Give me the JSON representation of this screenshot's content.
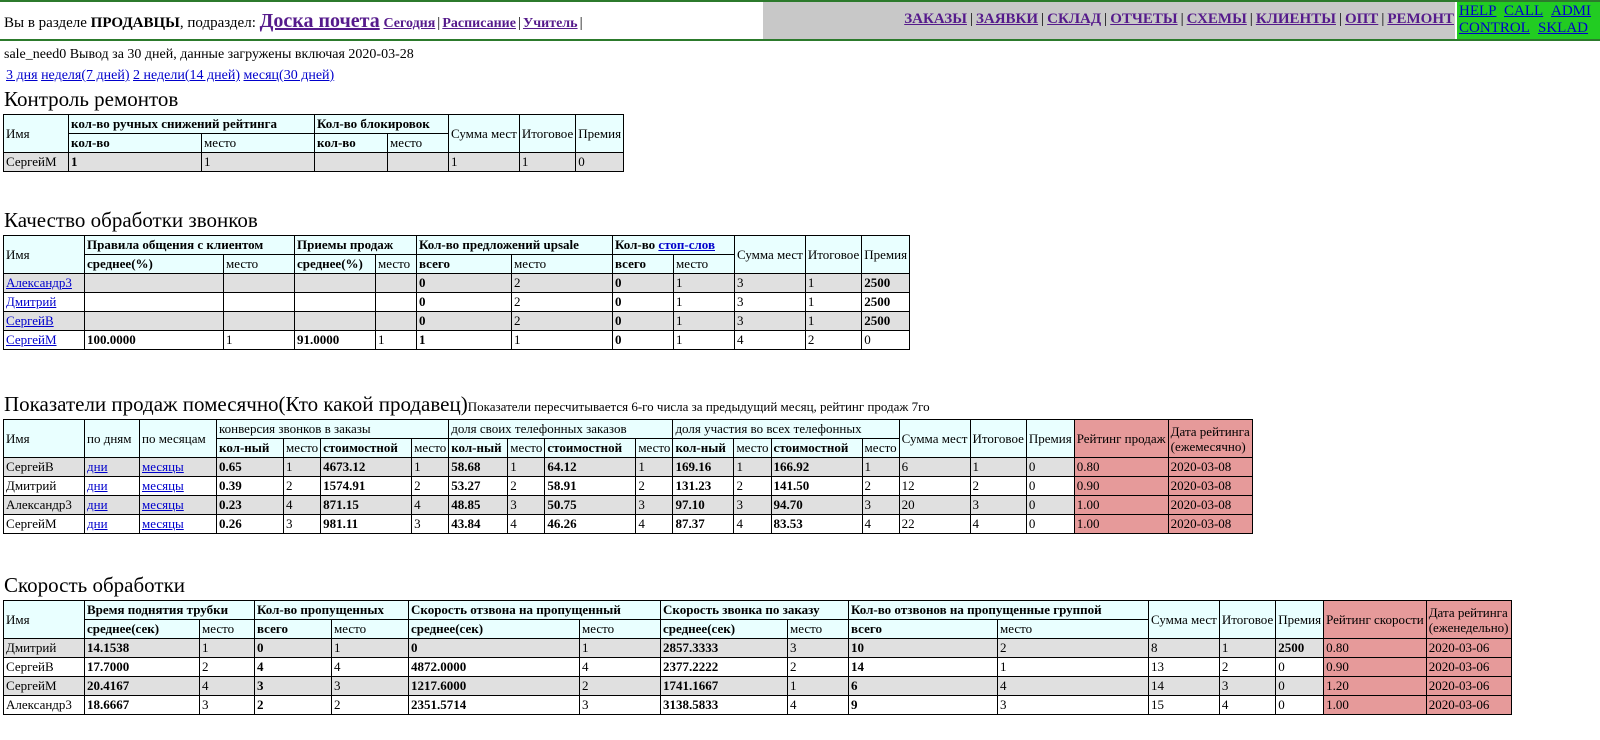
{
  "header": {
    "prefix": "Вы в разделе",
    "section": "ПРОДАВЦЫ",
    "subsection_label": ", подраздел:",
    "current": "Доска почета",
    "links": [
      "Сегодня",
      "Расписание",
      "Учитель"
    ],
    "menu": [
      "ЗАКАЗЫ",
      "ЗАЯВКИ",
      "СКЛАД",
      "ОТЧЕТЫ",
      "СХЕМЫ",
      "КЛИЕНТЫ",
      "ОПТ",
      "РЕМОНТ"
    ],
    "green_links": [
      "HELP",
      "CALL",
      "ADMI",
      "CONTROL",
      "SKLAD"
    ],
    "colors": {
      "border": "#2c7a2c",
      "gray": "#c8c8c8",
      "green": "#22cc22"
    }
  },
  "info": "sale_need0 Вывод за 30 дней, данные загружены включая 2020-03-28",
  "periods": [
    "3 дня",
    "неделя(7 дней)",
    "2 недели(14 дней)",
    "месяц(30 дней)"
  ],
  "repairs": {
    "title": "Контроль ремонтов",
    "h": {
      "name": "Имя",
      "manual": "кол-во ручных снижений рейтинга",
      "blocks": "Кол-во блокировок",
      "sum": "Сумма мест",
      "total": "Итоговое",
      "bonus": "Премия",
      "count": "кол-во",
      "place": "место"
    },
    "rows": [
      [
        "СергейМ",
        "1",
        "1",
        "",
        "",
        "1",
        "1",
        "0"
      ]
    ]
  },
  "calls": {
    "title": "Качество обработки звонков",
    "h": {
      "name": "Имя",
      "rules": "Правила общения с клиентом",
      "tech": "Приемы продаж",
      "upsale": "Кол-во предложений upsale",
      "stop_prefix": "Кол-во",
      "stop_link": "стоп-слов",
      "sum": "Сумма мест",
      "total": "Итоговое",
      "bonus": "Премия",
      "avg": "среднее(%)",
      "place": "место",
      "all": "всего"
    },
    "rows": [
      [
        "Александр3",
        "",
        "",
        "",
        "",
        "0",
        "2",
        "0",
        "1",
        "3",
        "1",
        "2500"
      ],
      [
        "Дмитрий",
        "",
        "",
        "",
        "",
        "0",
        "2",
        "0",
        "1",
        "3",
        "1",
        "2500"
      ],
      [
        "СергейВ",
        "",
        "",
        "",
        "",
        "0",
        "2",
        "0",
        "1",
        "3",
        "1",
        "2500"
      ],
      [
        "СергейМ",
        "100.0000",
        "1",
        "91.0000",
        "1",
        "1",
        "1",
        "0",
        "1",
        "4",
        "2",
        "0"
      ]
    ]
  },
  "sales": {
    "title": "Показатели продаж помесячно(Кто какой продавец)",
    "note": "Показатели пересчитывается 6-го числа за предыдущий месяц, рейтинг продаж 7го",
    "h": {
      "name": "Имя",
      "by_days": "по дням",
      "by_months": "по месяцам",
      "conv": "конверсия звонков в заказы",
      "own": "доля своих телефонных заказов",
      "part": "доля участия во всех телефонных",
      "qty": "кол-ный",
      "cost": "стоимостной",
      "place": "место",
      "sum": "Сумма мест",
      "total": "Итоговое",
      "bonus": "Премия",
      "rating": "Рейтинг продаж",
      "date1": "Дата рейтинга",
      "date2": "(ежемесячно)"
    },
    "days_link": "дни",
    "months_link": "месяцы",
    "rows": [
      [
        "СергейВ",
        "0.65",
        "1",
        "4673.12",
        "1",
        "58.68",
        "1",
        "64.12",
        "1",
        "169.16",
        "1",
        "166.92",
        "1",
        "6",
        "1",
        "0",
        "0.80",
        "2020-03-08"
      ],
      [
        "Дмитрий",
        "0.39",
        "2",
        "1574.91",
        "2",
        "53.27",
        "2",
        "58.91",
        "2",
        "131.23",
        "2",
        "141.50",
        "2",
        "12",
        "2",
        "0",
        "0.90",
        "2020-03-08"
      ],
      [
        "Александр3",
        "0.23",
        "4",
        "871.15",
        "4",
        "48.85",
        "3",
        "50.75",
        "3",
        "97.10",
        "3",
        "94.70",
        "3",
        "20",
        "3",
        "0",
        "1.00",
        "2020-03-08"
      ],
      [
        "СергейМ",
        "0.26",
        "3",
        "981.11",
        "3",
        "43.84",
        "4",
        "46.26",
        "4",
        "87.37",
        "4",
        "83.53",
        "4",
        "22",
        "4",
        "0",
        "1.00",
        "2020-03-08"
      ]
    ]
  },
  "speed": {
    "title": "Скорость обработки",
    "h": {
      "name": "Имя",
      "pickup": "Время поднятия трубки",
      "missed": "Кол-во пропущенных",
      "callback": "Скорость отзвона на пропущенный",
      "order": "Скорость звонка по заказу",
      "group": "Кол-во отзвонов на пропущенные группой",
      "avg": "среднее(сек)",
      "place": "место",
      "all": "всего",
      "sum": "Сумма мест",
      "total": "Итоговое",
      "bonus": "Премия",
      "rating": "Рейтинг скорости",
      "date1": "Дата рейтинга",
      "date2": "(еженедельно)"
    },
    "rows": [
      [
        "Дмитрий",
        "14.1538",
        "1",
        "0",
        "1",
        "0",
        "1",
        "2857.3333",
        "3",
        "10",
        "2",
        "8",
        "1",
        "2500",
        "0.80",
        "2020-03-06"
      ],
      [
        "СергейВ",
        "17.7000",
        "2",
        "4",
        "4",
        "4872.0000",
        "4",
        "2377.2222",
        "2",
        "14",
        "1",
        "13",
        "2",
        "0",
        "0.90",
        "2020-03-06"
      ],
      [
        "СергейМ",
        "20.4167",
        "4",
        "3",
        "3",
        "1217.6000",
        "2",
        "1741.1667",
        "1",
        "6",
        "4",
        "14",
        "3",
        "0",
        "1.20",
        "2020-03-06"
      ],
      [
        "Александр3",
        "18.6667",
        "3",
        "2",
        "2",
        "2351.5714",
        "3",
        "3138.5833",
        "4",
        "9",
        "3",
        "15",
        "4",
        "0",
        "1.00",
        "2020-03-06"
      ]
    ]
  }
}
